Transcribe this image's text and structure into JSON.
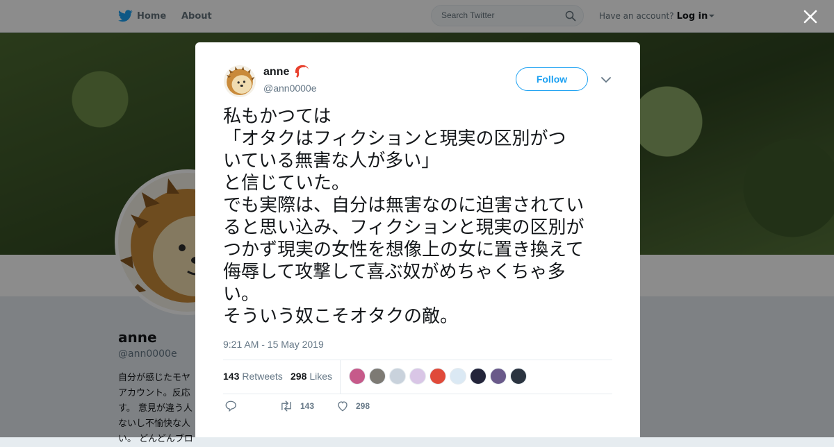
{
  "topbar": {
    "nav": [
      {
        "label": "Home"
      },
      {
        "label": "About"
      }
    ],
    "search_placeholder": "Search Twitter",
    "have_account": "Have an account?",
    "login": "Log in"
  },
  "profile": {
    "name": "anne",
    "handle": "@ann0000e",
    "bio_lines": [
      "自分が感じたモヤ",
      "アカウント。反応",
      "す。 意見が違う人",
      "ないし不愉快な人",
      "い。 どんどんブロ"
    ]
  },
  "tweet": {
    "author_name": "anne",
    "author_handle": "@ann0000e",
    "follow_label": "Follow",
    "text_lines": [
      "私もかつては",
      "「オタクはフィクションと現実の区別がつ",
      "いている無害な人が多い」",
      "と信じていた。",
      "でも実際は、自分は無害なのに迫害されてい",
      "ると思い込み、フィクションと現実の区別が",
      "つかず現実の女性を想像上の女に置き換えて",
      "侮辱して攻撃して喜ぶ奴がめちゃくちゃ多",
      "い。",
      "そういう奴こそオタクの敵。"
    ],
    "timestamp": "9:21 AM - 15 May 2019",
    "retweets_count": "143",
    "retweets_label": "Retweets",
    "likes_count": "298",
    "likes_label": "Likes",
    "likers": [
      {
        "name": "liker-1",
        "color": "#c65a8a"
      },
      {
        "name": "liker-2",
        "color": "#7d7a74"
      },
      {
        "name": "liker-3",
        "color": "#c9d2dc"
      },
      {
        "name": "liker-4",
        "color": "#d9c6e6"
      },
      {
        "name": "liker-5",
        "color": "#e04a3a"
      },
      {
        "name": "liker-6",
        "color": "#dbe9f4"
      },
      {
        "name": "liker-7",
        "color": "#23243a"
      },
      {
        "name": "liker-8",
        "color": "#6a5a8a"
      },
      {
        "name": "liker-9",
        "color": "#2b3440"
      }
    ],
    "actions": {
      "reply_count": "",
      "retweet_count": "143",
      "like_count": "298"
    }
  },
  "colors": {
    "accent": "#1da1f2",
    "text": "#14171a",
    "muted": "#657786"
  }
}
